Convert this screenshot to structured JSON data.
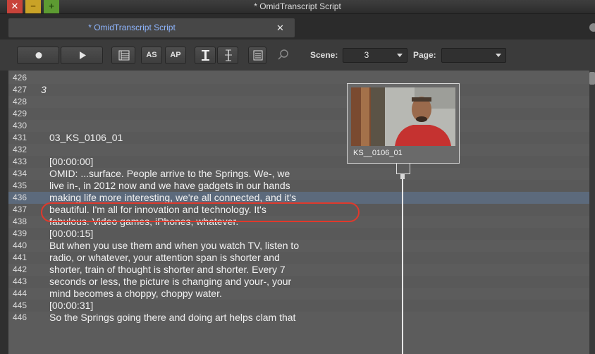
{
  "window": {
    "title": "* OmidTranscript Script",
    "buttons": {
      "close": "✕",
      "minimize": "−",
      "maximize": "+"
    }
  },
  "tab": {
    "label": "* OmidTranscript Script",
    "close": "✕"
  },
  "toolbar": {
    "buttons": [
      "record",
      "play",
      "script-view",
      "AS",
      "AP",
      "text-cursor",
      "alt-cursor",
      "list-view",
      "search"
    ],
    "as_label": "AS",
    "ap_label": "AP",
    "scene_label": "Scene:",
    "scene_value": "3",
    "page_label": "Page:",
    "page_value": ""
  },
  "clip": {
    "name": "KS__0106_01"
  },
  "lines": [
    {
      "num": "426",
      "text": ""
    },
    {
      "num": "427",
      "text": "3",
      "scene": true
    },
    {
      "num": "428",
      "text": ""
    },
    {
      "num": "429",
      "text": ""
    },
    {
      "num": "430",
      "text": ""
    },
    {
      "num": "431",
      "text": "03_KS_0106_01"
    },
    {
      "num": "432",
      "text": ""
    },
    {
      "num": "433",
      "text": "[00:00:00]"
    },
    {
      "num": "434",
      "text": "OMID:  ...surface.  People arrive to the Springs.  We-, we"
    },
    {
      "num": "435",
      "text": "live in-, in 2012 now and we have gadgets in our hands"
    },
    {
      "num": "436",
      "text": "making life more interesting, we're all connected, and it's",
      "selected": true
    },
    {
      "num": "437",
      "text": "beautiful.  I'm all for innovation and technology.  It's"
    },
    {
      "num": "438",
      "text": "fabulous.  Video games, iPhones, whatever."
    },
    {
      "num": "439",
      "text": "[00:00:15]"
    },
    {
      "num": "440",
      "text": "But when you use them and when you watch TV, listen to"
    },
    {
      "num": "441",
      "text": "radio, or whatever, your attention span is shorter and"
    },
    {
      "num": "442",
      "text": "shorter, train of thought is shorter and shorter.  Every 7"
    },
    {
      "num": "443",
      "text": "seconds or less, the picture is changing and your-, your"
    },
    {
      "num": "444",
      "text": "mind becomes a choppy, choppy water."
    },
    {
      "num": "445",
      "text": "[00:00:31]"
    },
    {
      "num": "446",
      "text": "So the Springs going there and doing art helps clam that"
    }
  ],
  "colors": {
    "tab_text": "#8fb6ff",
    "selected_row": "#5c6a7c",
    "annotation": "#e0392c"
  }
}
